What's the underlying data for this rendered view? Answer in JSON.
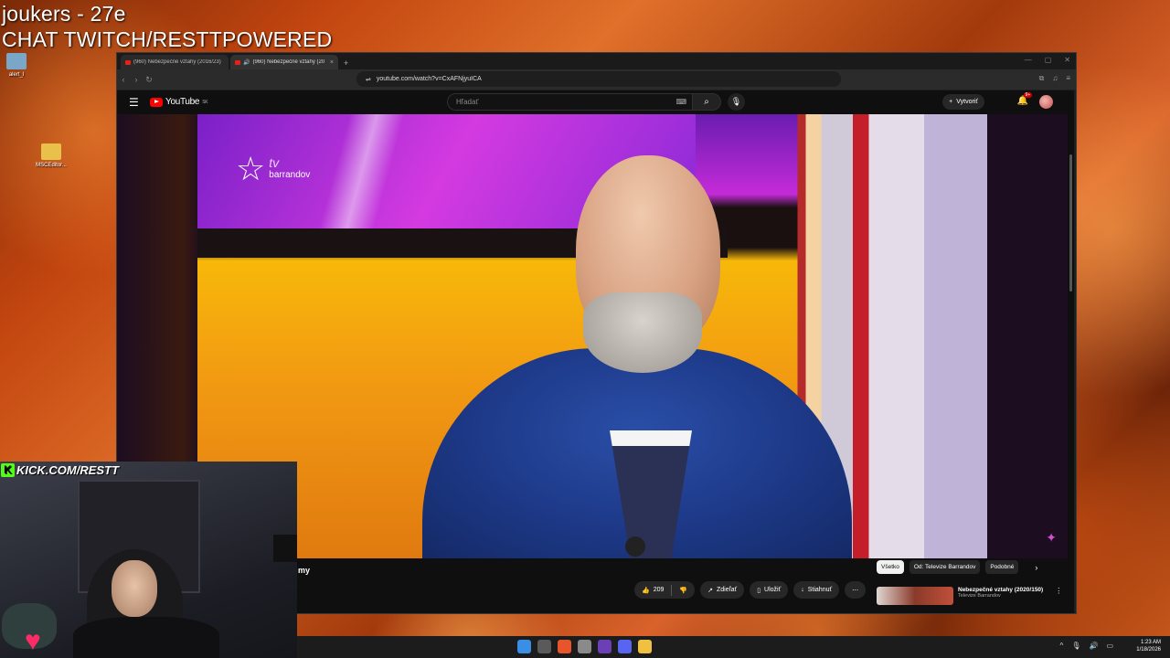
{
  "overlay": {
    "line1": "joukers - 27e",
    "line2": "CHAT TWITCH/RESTTPOWERED",
    "kick": "KICK.COM/RESTT"
  },
  "desktop": {
    "icons": [
      {
        "label": "alert_l",
        "icon": "recycle-icon"
      },
      {
        "label": "MSCEditor...",
        "icon": "folder-icon"
      }
    ]
  },
  "browser": {
    "tabs": [
      {
        "title": "(960) Nebezpečné vztahy (2016/23)",
        "active": false
      },
      {
        "title": "(960) Nebezpečné vztahy (20",
        "active": true
      }
    ],
    "new_tab": "+",
    "url": "youtube.com/watch?v=CxAFNjyuICA"
  },
  "youtube": {
    "logo": "YouTube",
    "region": "SK",
    "search_placeholder": "Hľadať",
    "create_label": "Vytvoriť",
    "notif_count": "9+",
    "video": {
      "channel_logo_top": "tv",
      "channel_logo_bottom": "barrandov",
      "title_fragment": "my"
    },
    "actions": {
      "like_count": "209",
      "share": "Zdieľať",
      "save": "Uložiť",
      "download": "Stiahnuť",
      "more": "⋯"
    },
    "chips": [
      "Všetko",
      "Od: Televize Barrandov",
      "Podobné"
    ],
    "recommendation": {
      "title": "Nebezpečné vztahy (2020/150)",
      "channel": "Televize Barrandov"
    }
  },
  "taskbar": {
    "time": "1:23 AM",
    "date": "1/18/2026"
  },
  "colors": {
    "youtube_red": "#ff0000",
    "kick_green": "#53fc18",
    "tv_purple": "#c42bd8"
  }
}
